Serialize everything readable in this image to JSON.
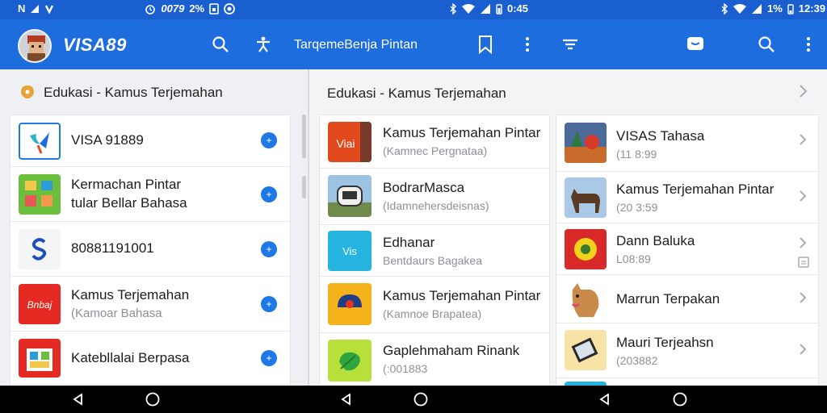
{
  "status_bar": {
    "left": {
      "carrier": "N",
      "time_text": "0079",
      "percent": "2%",
      "icons": [
        "n-signal-icon",
        "alarm-icon",
        "sim-icon",
        "record-icon"
      ]
    },
    "center": {
      "time": "0:45",
      "icons": [
        "bluetooth-icon",
        "wifi-icon",
        "signal-icon",
        "battery-icon"
      ]
    },
    "right": {
      "battery_percent": "1%",
      "time": "12:39",
      "icons": [
        "bluetooth-icon",
        "wifi-icon",
        "signal-icon",
        "battery-icon"
      ]
    }
  },
  "app_bar": {
    "brand": "VISA89",
    "title": "TarqemeBenja Pintan",
    "icons": [
      "search-icon",
      "accessibility-icon",
      "bookmark-icon",
      "more-vert-icon",
      "sort-icon",
      "chat-icon",
      "search-icon",
      "more-vert-icon"
    ]
  },
  "left_panel": {
    "header": "Edukasi - Kamus Terjemahan",
    "items": [
      {
        "title": "VISA 91889",
        "subtitle": "",
        "icon": "visa-logo-icon"
      },
      {
        "title": "Kermachan Pintar",
        "subtitle": "tular Bellar Bahasa",
        "icon": "green-grid-app-icon"
      },
      {
        "title": "80881191001",
        "subtitle": "",
        "icon": "s-logo-icon"
      },
      {
        "title": "Kamus Terjemahan",
        "subtitle": "(Kamoar Bahasa",
        "icon": "red-book-app-icon"
      },
      {
        "title": "Katebllalai Berpasa",
        "subtitle": "",
        "icon": "red-gift-app-icon"
      }
    ]
  },
  "right_panel": {
    "header": "Edukasi - Kamus Terjemahan",
    "col1": [
      {
        "title": "Kamus Terjemahan Pintar",
        "subtitle": "(Kamnec Pergnataa)",
        "icon_text": "Viai"
      },
      {
        "title": "BodrarMasca",
        "subtitle": "(Idamnehersdeisnas)",
        "icon_text": ""
      },
      {
        "title": "Edhanar",
        "subtitle": "Bentdaurs Bagakea",
        "icon_text": "Vis"
      },
      {
        "title": "Kamus Terjemahan Pintar",
        "subtitle": "(Kamnoe Brapatea)",
        "icon_text": ""
      },
      {
        "title": "Gaplehmaham Rinank",
        "subtitle": "(:001883",
        "icon_text": ""
      }
    ],
    "col2": [
      {
        "title": "VISAS Tahasa",
        "subtitle": "(11 8:99"
      },
      {
        "title": "Kamus Terjemahan Pintar",
        "subtitle": "(20 3:59"
      },
      {
        "title": "Dann Baluka",
        "subtitle": "L08:89"
      },
      {
        "title": "Marrun Terpakan",
        "subtitle": ""
      },
      {
        "title": "Mauri Terjeahsn",
        "subtitle": "(203882"
      }
    ]
  },
  "colors": {
    "primary": "#1e6ddf",
    "status_bar": "#1a5fd0",
    "accent_button": "#1e78e6"
  }
}
